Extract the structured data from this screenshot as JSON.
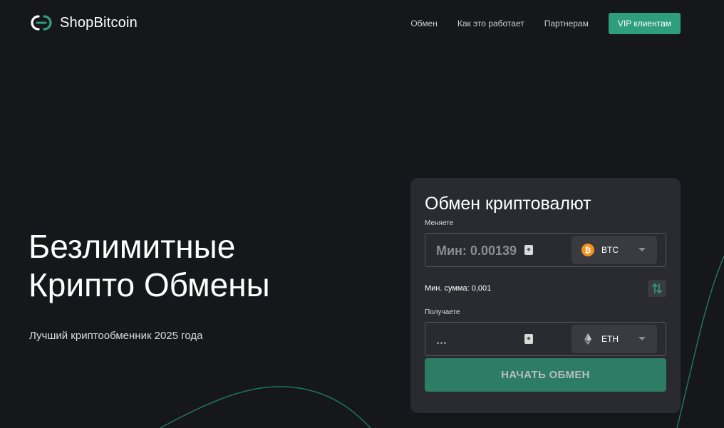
{
  "brand": {
    "name": "ShopBitcoin",
    "accent": "#2f9e7c",
    "logo_icon": "chain-link-logo"
  },
  "nav": {
    "items": [
      {
        "label": "Обмен"
      },
      {
        "label": "Как это работает"
      },
      {
        "label": "Партнерам"
      }
    ],
    "cta_label": "VIP клиентам"
  },
  "hero": {
    "title_line1": "Безлимитные",
    "title_line2": "Крипто Обмены",
    "subtitle": "Лучший криптообменник 2025 года"
  },
  "exchange": {
    "title": "Обмен криптовалют",
    "send": {
      "label": "Меняете",
      "placeholder": "Мин: 0.00139",
      "currency": {
        "code": "BTC",
        "icon": "bitcoin-icon",
        "color": "#f7931a"
      }
    },
    "min_sum": "Мин. сумма: 0,001",
    "swap_icon": "swap-arrows-icon",
    "receive": {
      "label": "Получаете",
      "value": "...",
      "currency": {
        "code": "ETH",
        "icon": "ethereum-icon"
      }
    },
    "submit_label": "НАЧАТЬ ОБМЕН"
  }
}
